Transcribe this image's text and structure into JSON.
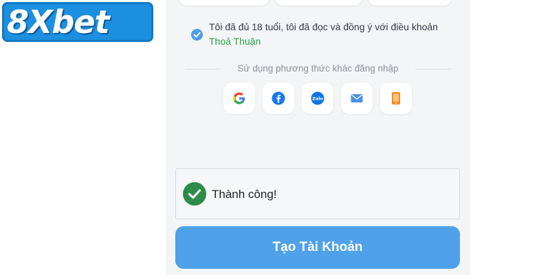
{
  "logo": {
    "text": "8Xbet"
  },
  "terms": {
    "checked": true,
    "text": "Tôi đã đủ 18 tuổi, tôi đã đọc và đồng ý với điều khoản ",
    "link": "Thoả Thuận"
  },
  "alt_login": {
    "label": "Sử dụng phương thức khác đăng nhập",
    "options": [
      {
        "icon": "google-icon"
      },
      {
        "icon": "facebook-icon"
      },
      {
        "icon": "zalo-icon",
        "label": "Zalo"
      },
      {
        "icon": "email-icon"
      },
      {
        "icon": "phone-icon"
      }
    ]
  },
  "toast": {
    "message": "Thành công!",
    "icon": "check-circle-icon"
  },
  "submit": {
    "label": "Tạo Tài Khoản"
  },
  "colors": {
    "panel_bg": "#f4f5f7",
    "button_bg": "#4fa1ea",
    "success_green": "#2e8b48",
    "link_green": "#2aa34a",
    "checkbox_blue": "#4f9be6"
  }
}
